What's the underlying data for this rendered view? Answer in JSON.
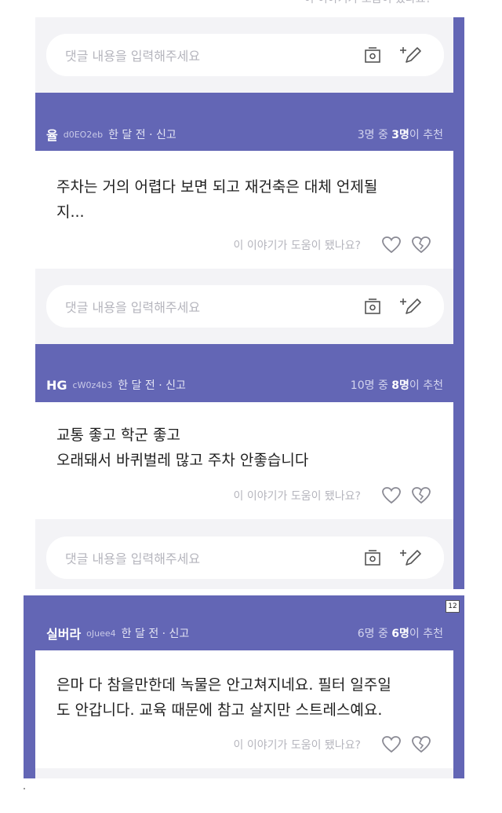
{
  "colors": {
    "panel": "#6366b5",
    "comment_area": "#f3f3f6"
  },
  "top_fragment": {
    "helpful_text": "이 이야기가 도움이 됐나요?",
    "comment_placeholder": "댓글 내용을 입력해주세요"
  },
  "reviews": [
    {
      "nickname": "율",
      "user_id": "d0EO2eb",
      "time_report": "한 달 전 · 신고",
      "rec_prefix": "3명 중 ",
      "rec_count": "3명",
      "rec_suffix": "이 추천",
      "text": "주차는 거의 어렵다 보면 되고 재건축은 대체 언제될\n지...",
      "helpful_text": "이 이야기가 도움이 됐나요?",
      "comment_placeholder": "댓글 내용을 입력해주세요"
    },
    {
      "nickname": "HG",
      "user_id": "cW0z4b3",
      "time_report": "한 달 전 · 신고",
      "rec_prefix": "10명 중 ",
      "rec_count": "8명",
      "rec_suffix": "이 추천",
      "text": "교통 좋고 학군 좋고\n오래돼서 바퀴벌레 많고 주차 안좋습니다",
      "helpful_text": "이 이야기가 도움이 됐나요?",
      "comment_placeholder": "댓글 내용을 입력해주세요"
    },
    {
      "nickname": "실버라",
      "user_id": "oJuee4",
      "time_report": "한 달 전 · 신고",
      "rec_prefix": "6명 중 ",
      "rec_count": "6명",
      "rec_suffix": "이 추천",
      "text": "은마 다 참을만한데 녹물은 안고쳐지네요. 필터 일주일\n도 안갑니다. 교육 때문에 참고 살지만 스트레스예요.",
      "helpful_text": "이 이야기가 도움이 됐나요?"
    }
  ],
  "page_badge": "12",
  "icons": {
    "photo": "camera-icon",
    "write": "add-pen-icon",
    "like": "heart-icon",
    "dislike": "broken-heart-icon"
  }
}
